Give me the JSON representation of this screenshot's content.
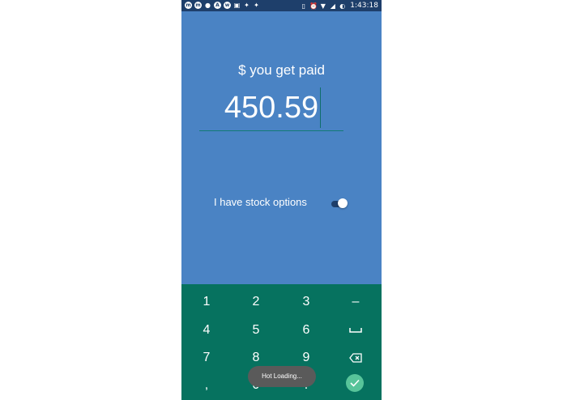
{
  "status_bar": {
    "time": "1:43:18",
    "left_icons": [
      "messenger-icon",
      "messenger-icon",
      "wechat-icon",
      "app-a-icon",
      "whatsapp-icon",
      "feedly-icon",
      "twitter-icon",
      "twitter-icon"
    ],
    "right_icons": [
      "vibrate-icon",
      "alarm-icon",
      "wifi-icon",
      "no-signal-icon",
      "battery-icon"
    ]
  },
  "app": {
    "prompt": "$ you get paid",
    "amount_value": "450.59",
    "stock_options_label": "I have stock options",
    "stock_options_enabled": true,
    "accent_color": "#4a83c4",
    "keyboard_color": "#06725f"
  },
  "keypad": {
    "keys": [
      [
        "1",
        "2",
        "3",
        "–"
      ],
      [
        "4",
        "5",
        "6",
        "space"
      ],
      [
        "7",
        "8",
        "9",
        "backspace"
      ],
      [
        ",",
        "0",
        ".",
        "done"
      ]
    ]
  },
  "toast": {
    "text": "Hot Loading..."
  }
}
